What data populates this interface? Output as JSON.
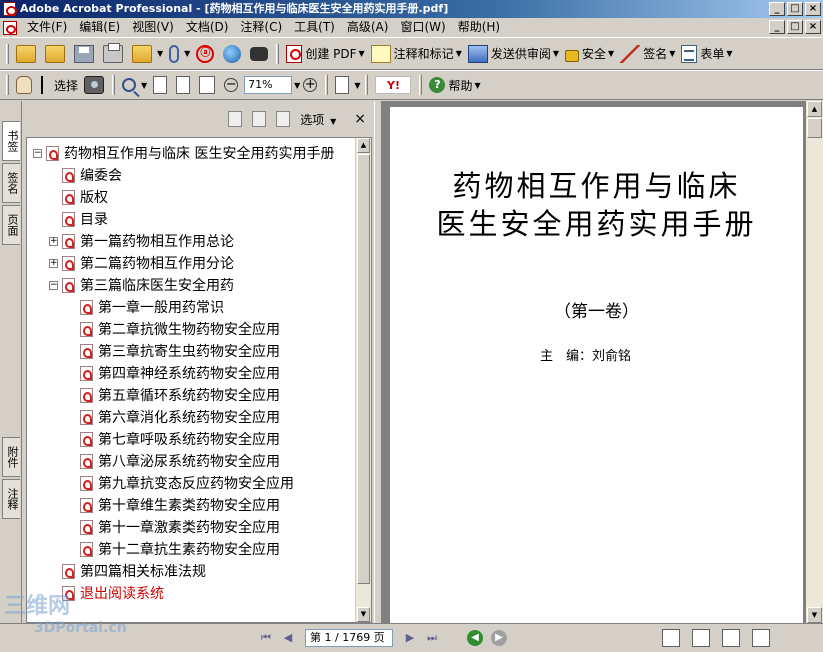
{
  "window": {
    "title": "Adobe Acrobat Professional - [药物相互作用与临床医生安全用药实用手册.pdf]",
    "min_label": "_",
    "max_label": "□",
    "close_label": "×"
  },
  "menubar": {
    "items": [
      "文件(F)",
      "编辑(E)",
      "视图(V)",
      "文档(D)",
      "注释(C)",
      "工具(T)",
      "高级(A)",
      "窗口(W)",
      "帮助(H)"
    ]
  },
  "toolbar1": {
    "create_pdf": "创建 PDF",
    "comment_markup": "注释和标记",
    "send_review": "发送供审阅",
    "secure": "安全",
    "sign": "签名",
    "forms": "表单",
    "acrobat_icon_text": "ⓐ"
  },
  "toolbar2": {
    "select_label": "选择",
    "zoom_value": "71%",
    "help_label": "帮助",
    "yahoo_label": "Y!"
  },
  "side_tabs": [
    "书签",
    "签名",
    "页面",
    "附件",
    "注释"
  ],
  "bookmarks": {
    "options_label": "选项",
    "close_label": "×",
    "items": [
      {
        "label": "药物相互作用与临床 医生安全用药实用手册",
        "level": 0,
        "expander": "⊟",
        "color": "black"
      },
      {
        "label": "编委会",
        "level": 1,
        "expander": "",
        "color": "black"
      },
      {
        "label": "版权",
        "level": 1,
        "expander": "",
        "color": "black"
      },
      {
        "label": "目录",
        "level": 1,
        "expander": "",
        "color": "black"
      },
      {
        "label": "第一篇药物相互作用总论",
        "level": 1,
        "expander": "⊞",
        "color": "black"
      },
      {
        "label": "第二篇药物相互作用分论",
        "level": 1,
        "expander": "⊞",
        "color": "black"
      },
      {
        "label": "第三篇临床医生安全用药",
        "level": 1,
        "expander": "⊟",
        "color": "black"
      },
      {
        "label": "第一章一般用药常识",
        "level": 2,
        "expander": "",
        "color": "black"
      },
      {
        "label": "第二章抗微生物药物安全应用",
        "level": 2,
        "expander": "",
        "color": "black"
      },
      {
        "label": "第三章抗寄生虫药物安全应用",
        "level": 2,
        "expander": "",
        "color": "black"
      },
      {
        "label": "第四章神经系统药物安全应用",
        "level": 2,
        "expander": "",
        "color": "black"
      },
      {
        "label": "第五章循环系统药物安全应用",
        "level": 2,
        "expander": "",
        "color": "black"
      },
      {
        "label": "第六章消化系统药物安全应用",
        "level": 2,
        "expander": "",
        "color": "black"
      },
      {
        "label": "第七章呼吸系统药物安全应用",
        "level": 2,
        "expander": "",
        "color": "black"
      },
      {
        "label": "第八章泌尿系统药物安全应用",
        "level": 2,
        "expander": "",
        "color": "black"
      },
      {
        "label": "第九章抗变态反应药物安全应用",
        "level": 2,
        "expander": "",
        "color": "black"
      },
      {
        "label": "第十章维生素类药物安全应用",
        "level": 2,
        "expander": "",
        "color": "black"
      },
      {
        "label": "第十一章激素类药物安全应用",
        "level": 2,
        "expander": "",
        "color": "black"
      },
      {
        "label": "第十二章抗生素药物安全应用",
        "level": 2,
        "expander": "",
        "color": "black"
      },
      {
        "label": "第四篇相关标准法规",
        "level": 1,
        "expander": "",
        "color": "black"
      },
      {
        "label": "退出阅读系统",
        "level": 0,
        "expander": "",
        "color": "red"
      }
    ]
  },
  "document": {
    "title_line1": "药物相互作用与临床",
    "title_line2": "医生安全用药实用手册",
    "volume": "（第一卷）",
    "editor": "主　编：刘俞铭"
  },
  "statusbar": {
    "page_indicator": "第 1 / 1769 页"
  },
  "watermark": {
    "line1": "三维网",
    "line2": "3DPortal.cn"
  }
}
